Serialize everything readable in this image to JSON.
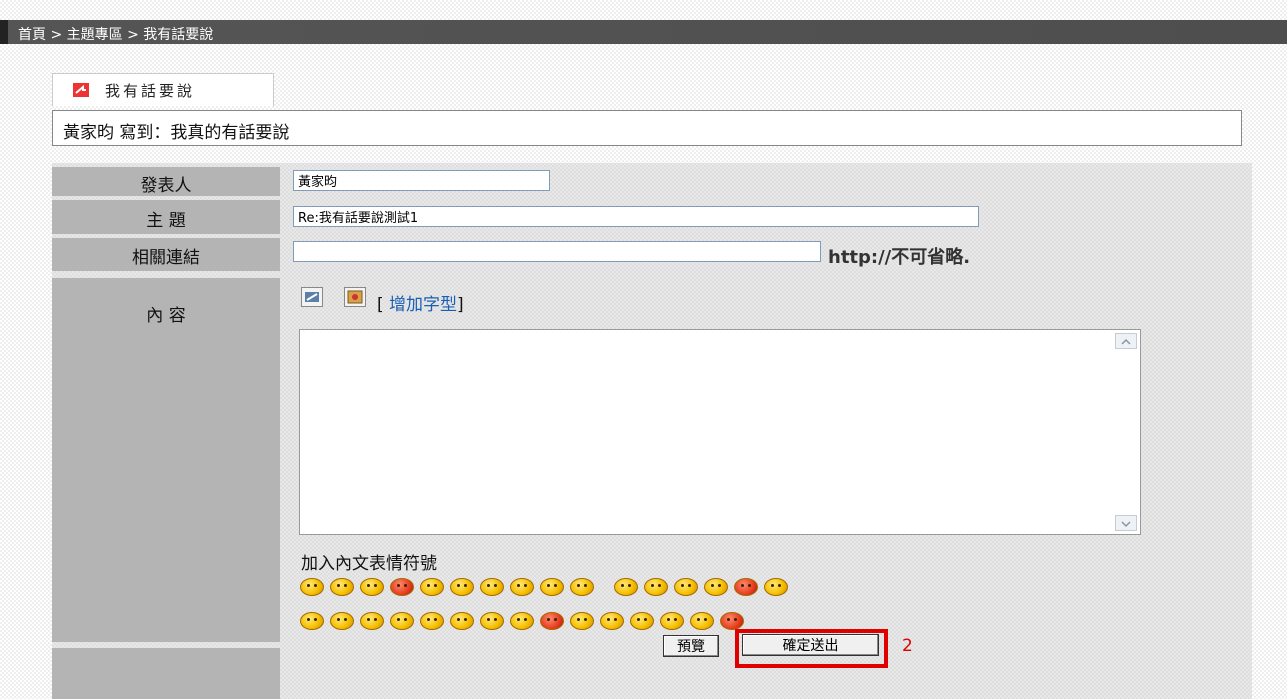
{
  "breadcrumb": "首頁 > 主題專區 > 我有話要說",
  "tab": {
    "label": "我有話要說",
    "icon": "tab-arrow-icon"
  },
  "post_heading": "黃家昀 寫到：我真的有話要說",
  "form": {
    "author": {
      "label": "發表人",
      "value": "黃家昀"
    },
    "subject": {
      "label": "主 題",
      "value": "Re:我有話要說測試1"
    },
    "link": {
      "label": "相關連結",
      "value": "",
      "hint": "http://不可省略."
    },
    "content": {
      "label": "內 容",
      "tools": [
        "link-tool-icon",
        "image-tool-icon"
      ],
      "add_font_open": "[ ",
      "add_font_link": "增加字型",
      "add_font_close": "]",
      "value": ""
    },
    "emoticons": {
      "title": "加入內文表情符號",
      "row1": [
        "smile",
        "wink",
        "cry",
        "angry",
        "sweat",
        "laugh",
        "sad",
        "surprise",
        "shy",
        "cool",
        "grin",
        "smirk",
        "tongue",
        "dizzy",
        "mad",
        "think"
      ],
      "row2": [
        "happy",
        "blush",
        "kiss",
        "love",
        "sleep",
        "shock",
        "laugh2",
        "evil",
        "devil",
        "confused",
        "cold",
        "angel",
        "sick",
        "grin2",
        "shout"
      ]
    }
  },
  "buttons": {
    "preview": "預覽",
    "submit": "確定送出"
  },
  "annotation": {
    "step": "2",
    "color": "#e00000"
  }
}
